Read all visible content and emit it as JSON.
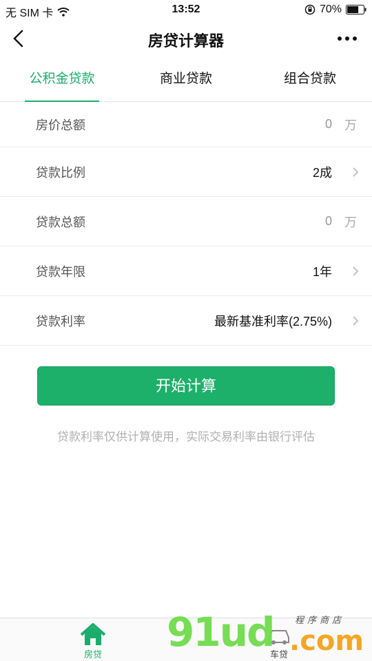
{
  "status_bar": {
    "carrier": "无 SIM 卡",
    "time": "13:52",
    "battery": "70%"
  },
  "nav": {
    "title": "房贷计算器"
  },
  "tabs": [
    {
      "label": "公积金贷款",
      "active": true
    },
    {
      "label": "商业贷款",
      "active": false
    },
    {
      "label": "组合贷款",
      "active": false
    }
  ],
  "form": {
    "rows": [
      {
        "label": "房价总额",
        "placeholder": "0",
        "unit": "万"
      },
      {
        "label": "贷款比例",
        "value": "2成"
      },
      {
        "label": "贷款总额",
        "placeholder": "0",
        "unit": "万"
      },
      {
        "label": "贷款年限",
        "value": "1年"
      },
      {
        "label": "贷款利率",
        "value": "最新基准利率(2.75%)"
      }
    ]
  },
  "calc_button": {
    "label": "开始计算"
  },
  "hint": "贷款利率仅供计算使用，实际交易利率由银行评估",
  "tab_bar": [
    {
      "label": "房贷",
      "icon": "house-icon",
      "active": true
    },
    {
      "label": "车贷",
      "icon": "car-icon",
      "active": false
    }
  ],
  "watermark": {
    "main": "91ud",
    "com": ".com",
    "sub": "程序商店"
  },
  "colors": {
    "accent": "#1aad6b",
    "button": "#1db06b",
    "hint": "#b0b0b0"
  }
}
